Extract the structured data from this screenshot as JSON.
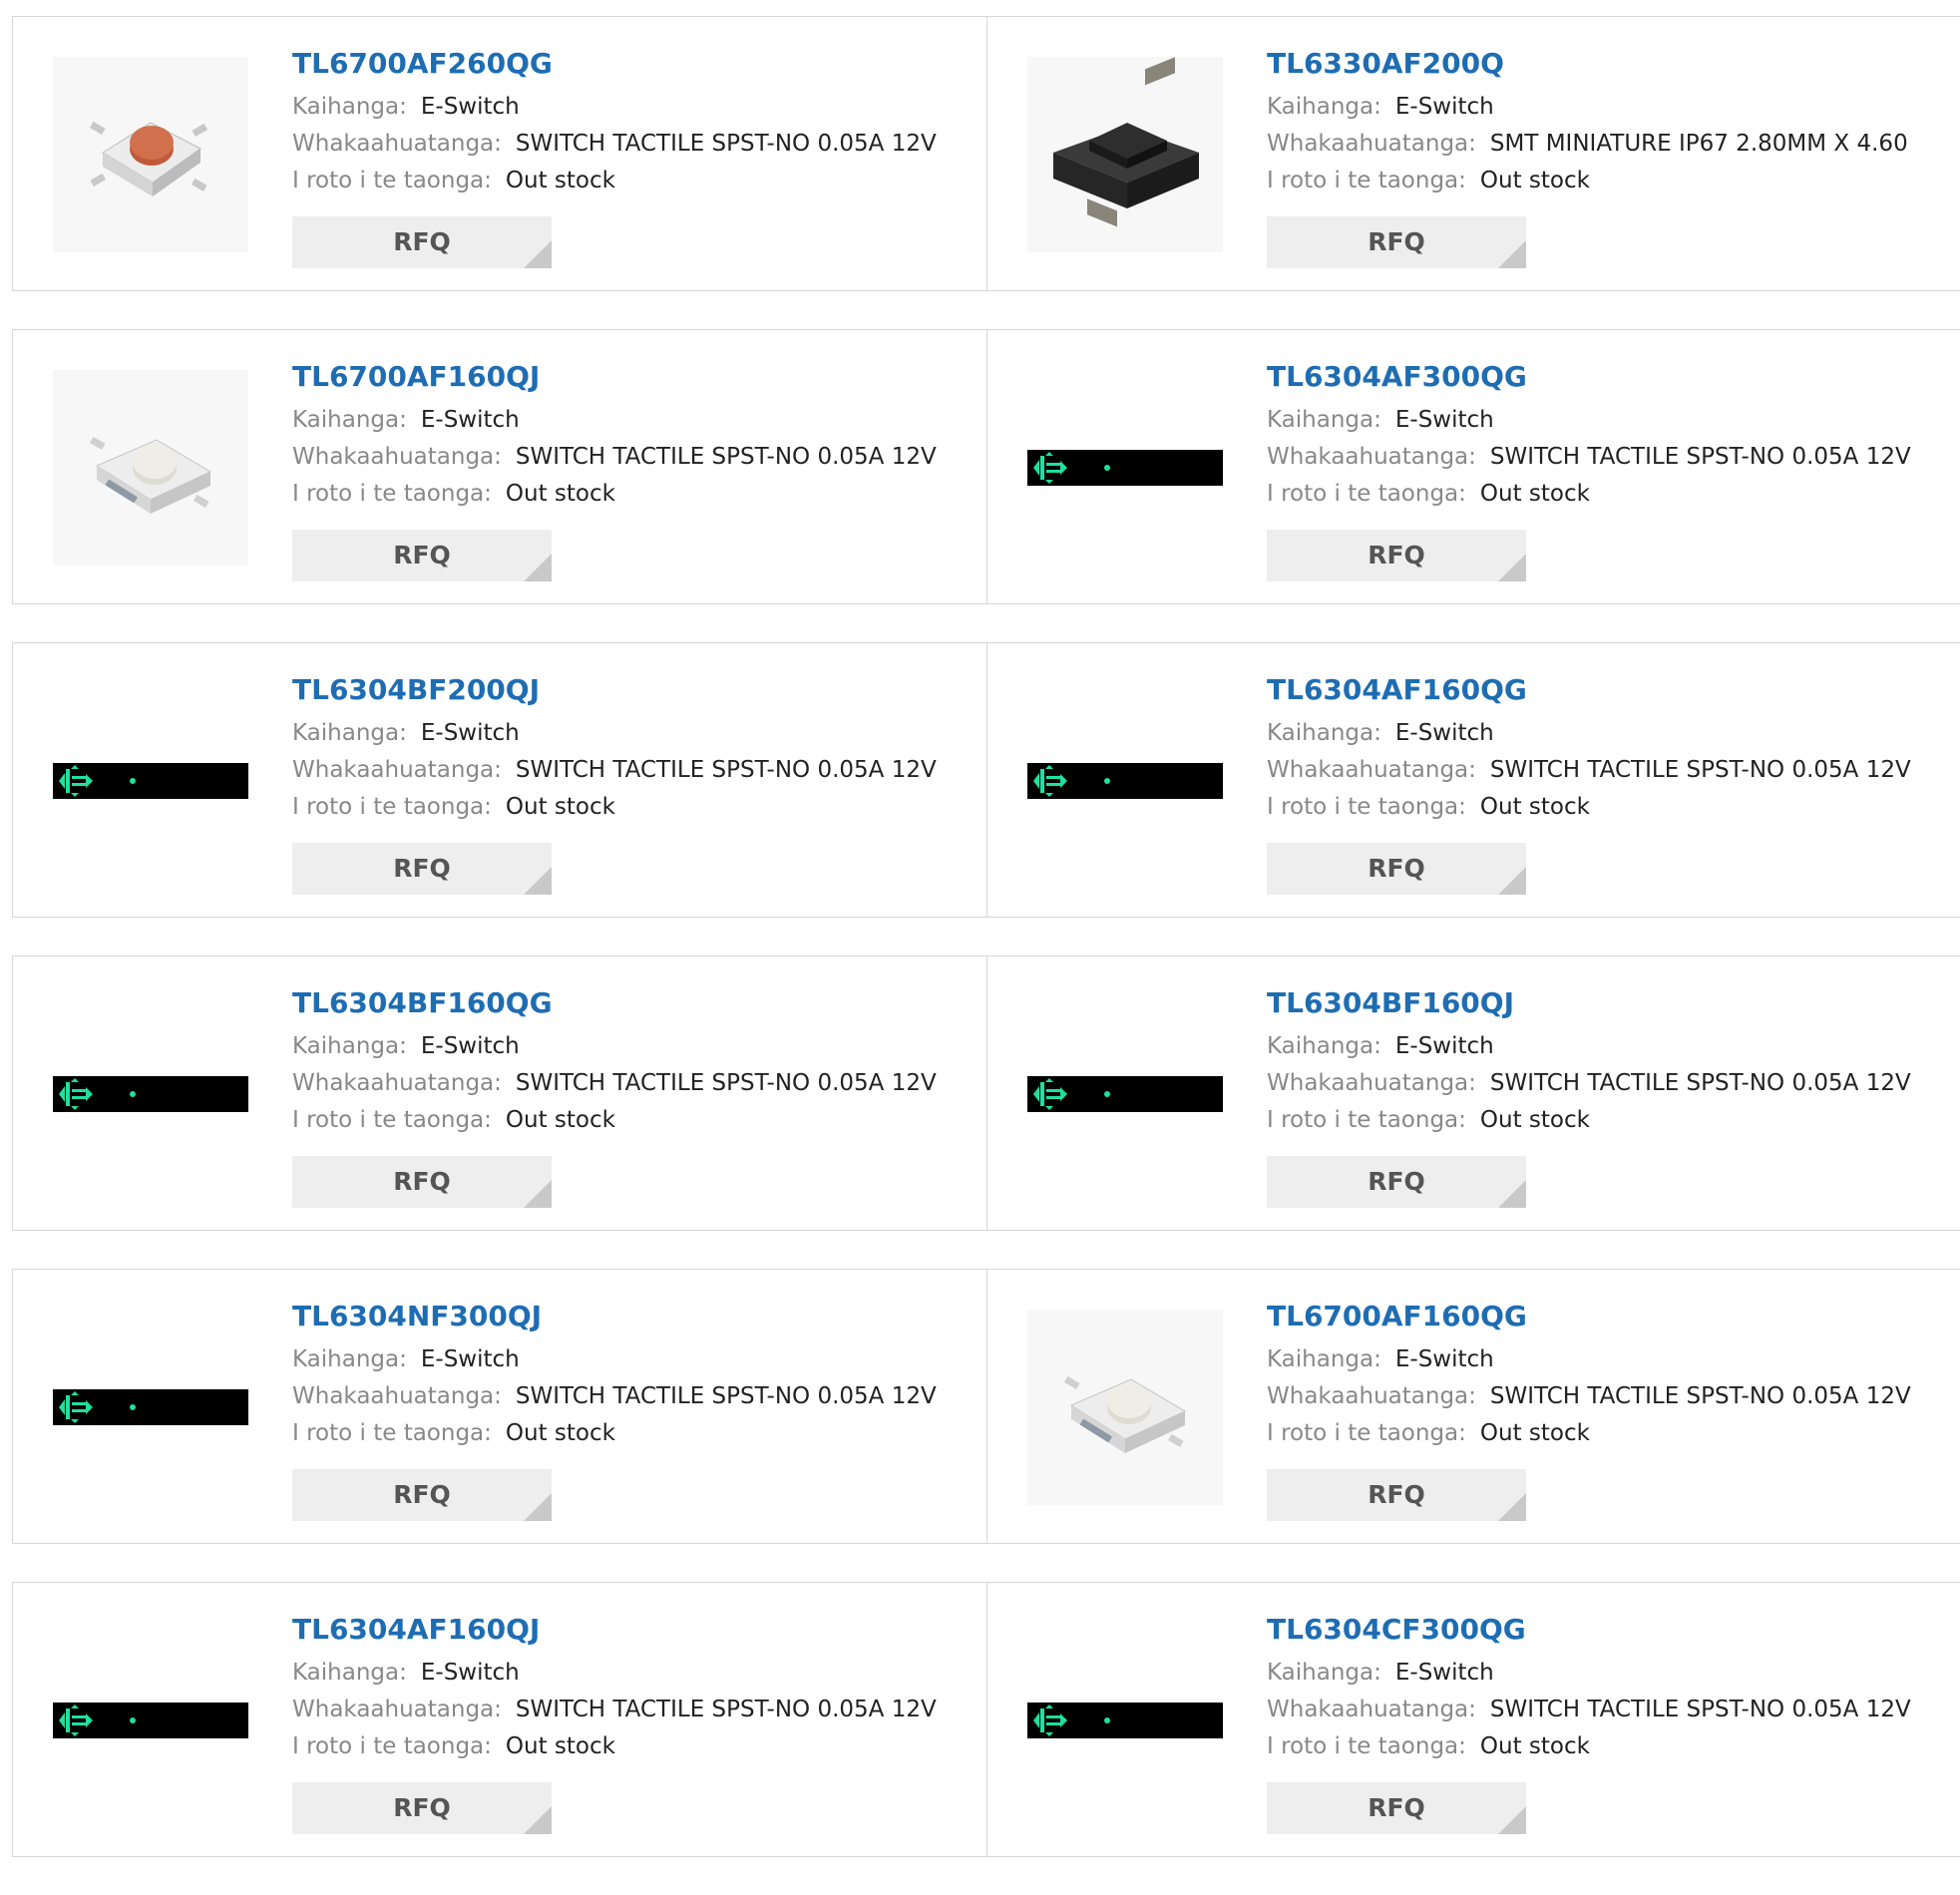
{
  "labels": {
    "manufacturer": "Kaihanga:",
    "description": "Whakaahuatanga:",
    "stock": "I roto i te taonga:",
    "rfq": "RFQ"
  },
  "products": [
    {
      "part": "TL6700AF260QG",
      "manufacturer": "E-Switch",
      "description": "SWITCH TACTILE SPST-NO 0.05A 12V",
      "stock": "Out stock",
      "image": "red-tactile-switch"
    },
    {
      "part": "TL6330AF200Q",
      "manufacturer": "E-Switch",
      "description": "SMT MINIATURE IP67 2.80MM X 4.60",
      "stock": "Out stock",
      "image": "black-smt-switch"
    },
    {
      "part": "TL6700AF160QJ",
      "manufacturer": "E-Switch",
      "description": "SWITCH TACTILE SPST-NO 0.05A 12V",
      "stock": "Out stock",
      "image": "white-tactile-switch"
    },
    {
      "part": "TL6304AF300QG",
      "manufacturer": "E-Switch",
      "description": "SWITCH TACTILE SPST-NO 0.05A 12V",
      "stock": "Out stock",
      "image": "placeholder-strip"
    },
    {
      "part": "TL6304BF200QJ",
      "manufacturer": "E-Switch",
      "description": "SWITCH TACTILE SPST-NO 0.05A 12V",
      "stock": "Out stock",
      "image": "placeholder-strip"
    },
    {
      "part": "TL6304AF160QG",
      "manufacturer": "E-Switch",
      "description": "SWITCH TACTILE SPST-NO 0.05A 12V",
      "stock": "Out stock",
      "image": "placeholder-strip"
    },
    {
      "part": "TL6304BF160QG",
      "manufacturer": "E-Switch",
      "description": "SWITCH TACTILE SPST-NO 0.05A 12V",
      "stock": "Out stock",
      "image": "placeholder-strip"
    },
    {
      "part": "TL6304BF160QJ",
      "manufacturer": "E-Switch",
      "description": "SWITCH TACTILE SPST-NO 0.05A 12V",
      "stock": "Out stock",
      "image": "placeholder-strip"
    },
    {
      "part": "TL6304NF300QJ",
      "manufacturer": "E-Switch",
      "description": "SWITCH TACTILE SPST-NO 0.05A 12V",
      "stock": "Out stock",
      "image": "placeholder-strip"
    },
    {
      "part": "TL6700AF160QG",
      "manufacturer": "E-Switch",
      "description": "SWITCH TACTILE SPST-NO 0.05A 12V",
      "stock": "Out stock",
      "image": "white-tactile-switch"
    },
    {
      "part": "TL6304AF160QJ",
      "manufacturer": "E-Switch",
      "description": "SWITCH TACTILE SPST-NO 0.05A 12V",
      "stock": "Out stock",
      "image": "placeholder-strip"
    },
    {
      "part": "TL6304CF300QG",
      "manufacturer": "E-Switch",
      "description": "SWITCH TACTILE SPST-NO 0.05A 12V",
      "stock": "Out stock",
      "image": "placeholder-strip"
    }
  ],
  "colors": {
    "title": "#1e6db3",
    "label": "#888888",
    "value": "#222222",
    "button_bg": "#eeeeee",
    "border": "#d6d6d6",
    "placeholder_bg": "#000000",
    "placeholder_icon": "#1ee0a0"
  }
}
